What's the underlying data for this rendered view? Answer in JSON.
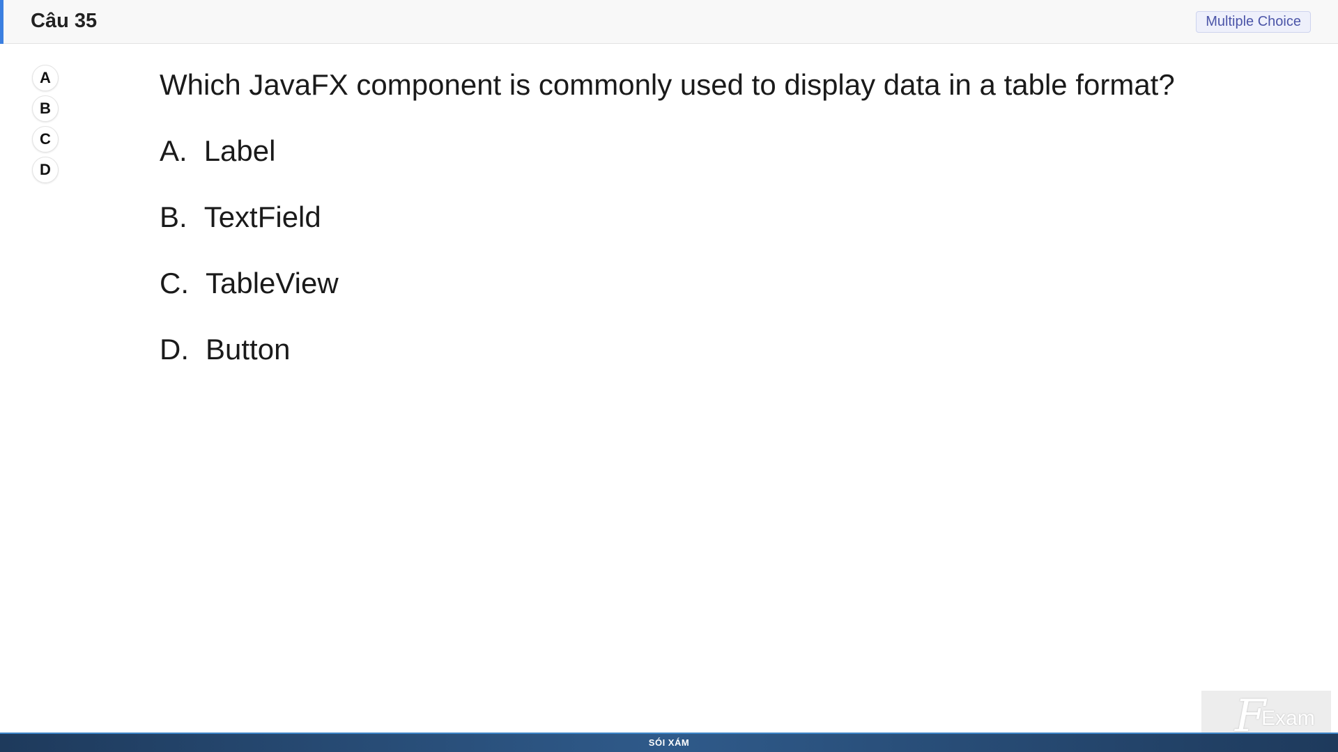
{
  "header": {
    "question_number": "Câu 35",
    "question_type": "Multiple Choice"
  },
  "answer_picker": [
    "A",
    "B",
    "C",
    "D"
  ],
  "question": {
    "text": "Which JavaFX component is commonly used to display data in a table format?",
    "options": [
      {
        "letter": "A.",
        "text": "Label"
      },
      {
        "letter": "B.",
        "text": "TextField"
      },
      {
        "letter": "C.",
        "text": "TableView"
      },
      {
        "letter": "D.",
        "text": "Button"
      }
    ]
  },
  "watermark": {
    "logo_letter": "F",
    "logo_text": "Exam"
  },
  "footer": {
    "label": "SÓI XÁM"
  },
  "colors": {
    "accent": "#3b7fe0",
    "badge_text": "#4b55a8",
    "footer_bg": "#2f5a8a"
  }
}
